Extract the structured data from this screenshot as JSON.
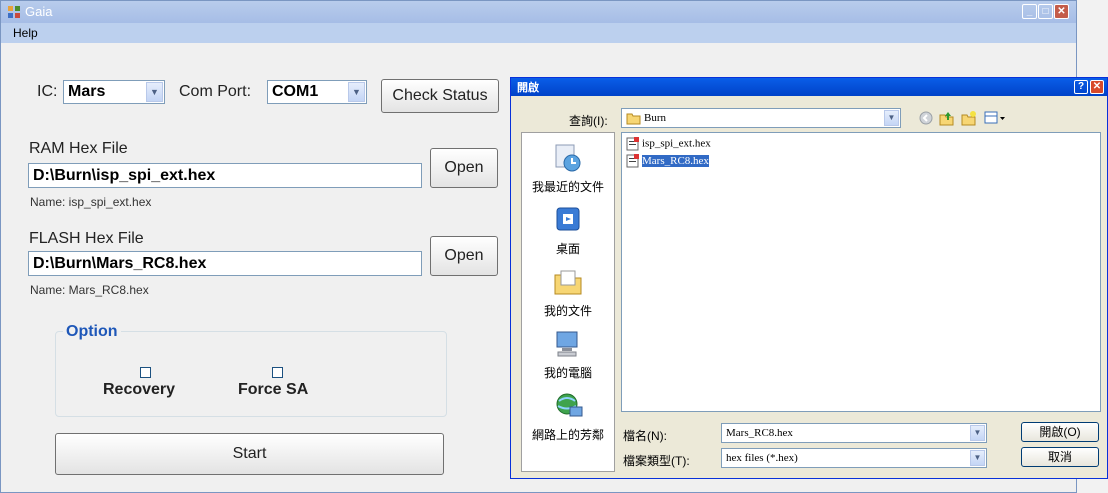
{
  "window": {
    "title": "Gaia"
  },
  "menu": {
    "help": "Help"
  },
  "main": {
    "ic_label": "IC:",
    "ic_value": "Mars",
    "comport_label": "Com Port:",
    "comport_value": "COM1",
    "check_status": "Check Status",
    "ram_label": "RAM Hex File",
    "ram_path": "D:\\Burn\\isp_spi_ext.hex",
    "ram_name": "Name: isp_spi_ext.hex",
    "open_ram": "Open",
    "flash_label": "FLASH Hex File",
    "flash_path": "D:\\Burn\\Mars_RC8.hex",
    "flash_name": "Name: Mars_RC8.hex",
    "open_flash": "Open",
    "option_title": "Option",
    "recovery": "Recovery",
    "force_sa": "Force SA",
    "start": "Start"
  },
  "dialog": {
    "title": "開啟",
    "lookin_label": "查詢(I):",
    "lookin_value": "Burn",
    "places": [
      "我最近的文件",
      "桌面",
      "我的文件",
      "我的電腦",
      "網路上的芳鄰"
    ],
    "files": [
      {
        "name": "isp_spi_ext.hex",
        "selected": false
      },
      {
        "name": "Mars_RC8.hex",
        "selected": true
      }
    ],
    "filename_label": "檔名(N):",
    "filename_value": "Mars_RC8.hex",
    "filetype_label": "檔案類型(T):",
    "filetype_value": "hex files (*.hex)",
    "open_button": "開啟(O)",
    "cancel_button": "取消"
  }
}
